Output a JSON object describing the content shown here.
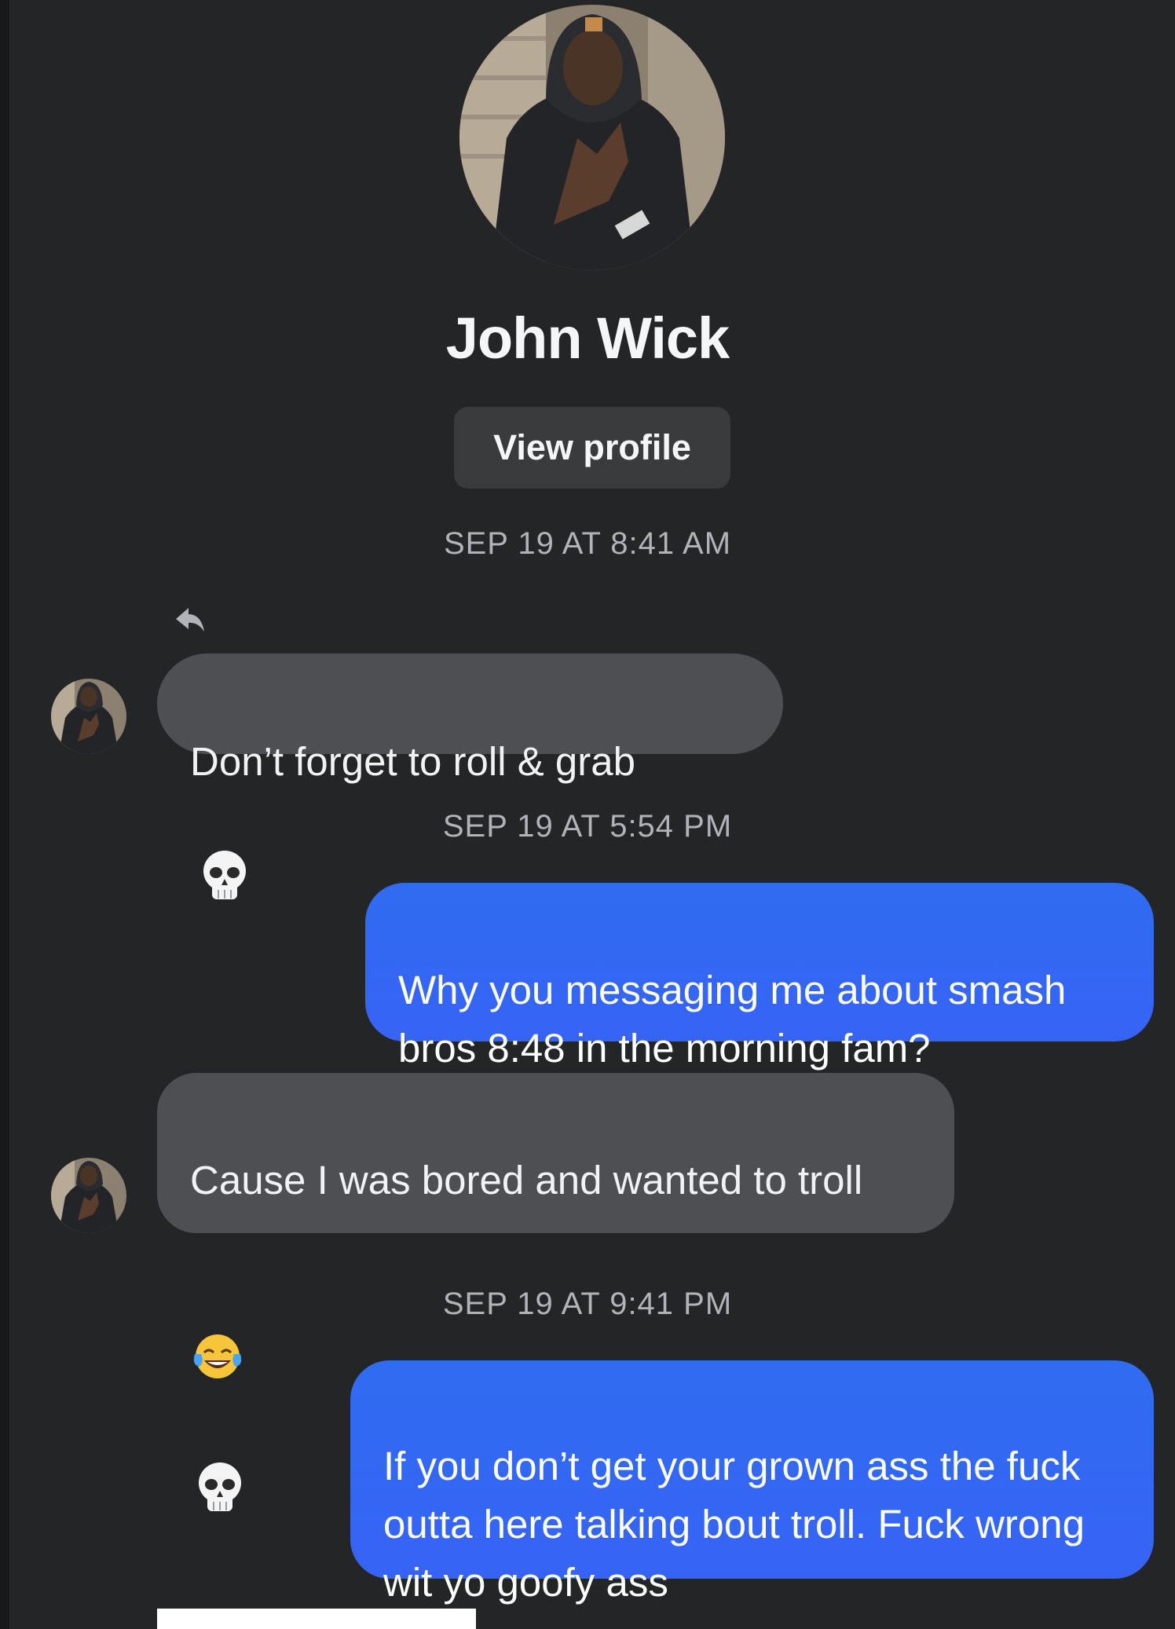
{
  "colors": {
    "background": "#242526",
    "incoming_bubble": "#4e4f52",
    "outgoing_bubble": "#3763f5",
    "button": "#3a3b3c",
    "timestamp": "#b0b3b8"
  },
  "header": {
    "name": "John Wick",
    "view_profile_label": "View profile",
    "avatar_icon": "profile-photo"
  },
  "messages": [
    {
      "type": "timestamp",
      "text": "SEP 19 AT 8:41 AM"
    },
    {
      "type": "incoming",
      "text": "Don’t forget to roll & grab",
      "emojis": [
        "skull"
      ],
      "replied": true
    },
    {
      "type": "timestamp",
      "text": "SEP 19 AT 5:54 PM"
    },
    {
      "type": "outgoing",
      "text": "Why you messaging me about smash bros 8:48 in the morning fam?"
    },
    {
      "type": "incoming",
      "text": "Cause I was bored and wanted to troll",
      "emojis": [
        "face-with-tears-of-joy",
        "skull"
      ]
    },
    {
      "type": "timestamp",
      "text": "SEP 19 AT 9:41 PM"
    },
    {
      "type": "outgoing",
      "text": "If you don’t get your grown ass the fuck outta here talking bout troll. Fuck wrong wit yo goofy ass"
    }
  ]
}
